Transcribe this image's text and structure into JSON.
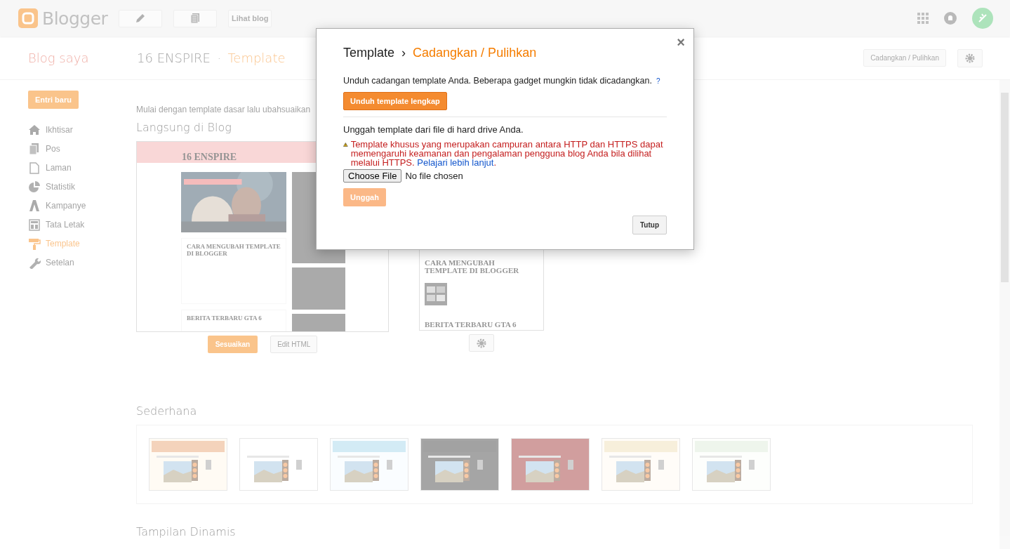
{
  "topbar": {
    "logo": "Blogger",
    "view_blog": "Lihat blog"
  },
  "header": {
    "blog_list": "Blog saya",
    "blog_name": "16 ENSPIRE",
    "separator": "·",
    "page": "Template",
    "backup_button": "Cadangkan / Pulihkan"
  },
  "sidebar": {
    "new_post": "Entri baru",
    "items": [
      {
        "label": "Ikhtisar",
        "selected": false
      },
      {
        "label": "Pos",
        "selected": false
      },
      {
        "label": "Laman",
        "selected": false
      },
      {
        "label": "Statistik",
        "selected": false
      },
      {
        "label": "Kampanye",
        "selected": false
      },
      {
        "label": "Tata Letak",
        "selected": false
      },
      {
        "label": "Template",
        "selected": true
      },
      {
        "label": "Setelan",
        "selected": false
      }
    ]
  },
  "content": {
    "intro": "Mulai dengan template dasar lalu ubahsuaikan",
    "live_section": "Langsung di Blog",
    "desktop_preview": {
      "blog_title": "16 ENSPIRE",
      "post_title": "CARA MENGUBAH TEMPLATE DI BLOGGER",
      "next_post": "BERITA TERBARU GTA 6"
    },
    "customize_button": "Sesuaikan",
    "edit_html_button": "Edit HTML",
    "mobile_preview": {
      "post_title": "CARA MENGUBAH TEMPLATE DI BLOGGER",
      "next_post": "BERITA TERBARU GTA 6"
    },
    "simple_section": "Sederhana",
    "dynamic_section": "Tampilan Dinamis"
  },
  "dialog": {
    "title": "Template",
    "breadcrumb_sep": "›",
    "subtitle": "Cadangkan / Pulihkan",
    "close": "×",
    "download_text": "Unduh cadangan template Anda. Beberapa gadget mungkin tidak dicadangkan.",
    "help": "?",
    "download_button": "Unduh template lengkap",
    "upload_text": "Unggah template dari file di hard drive Anda.",
    "warning": "Template khusus yang merupakan campuran antara HTTP dan HTTPS dapat memengaruhi keamanan dan pengalaman pengguna blog Anda bila dilihat melalui HTTPS.",
    "learn_more": "Pelajari lebih lanjut",
    "warning_end": ".",
    "choose_file": "Choose File",
    "no_file": "No file chosen",
    "upload_button": "Unggah",
    "upload_disabled": true,
    "close_button": "Tutup"
  }
}
